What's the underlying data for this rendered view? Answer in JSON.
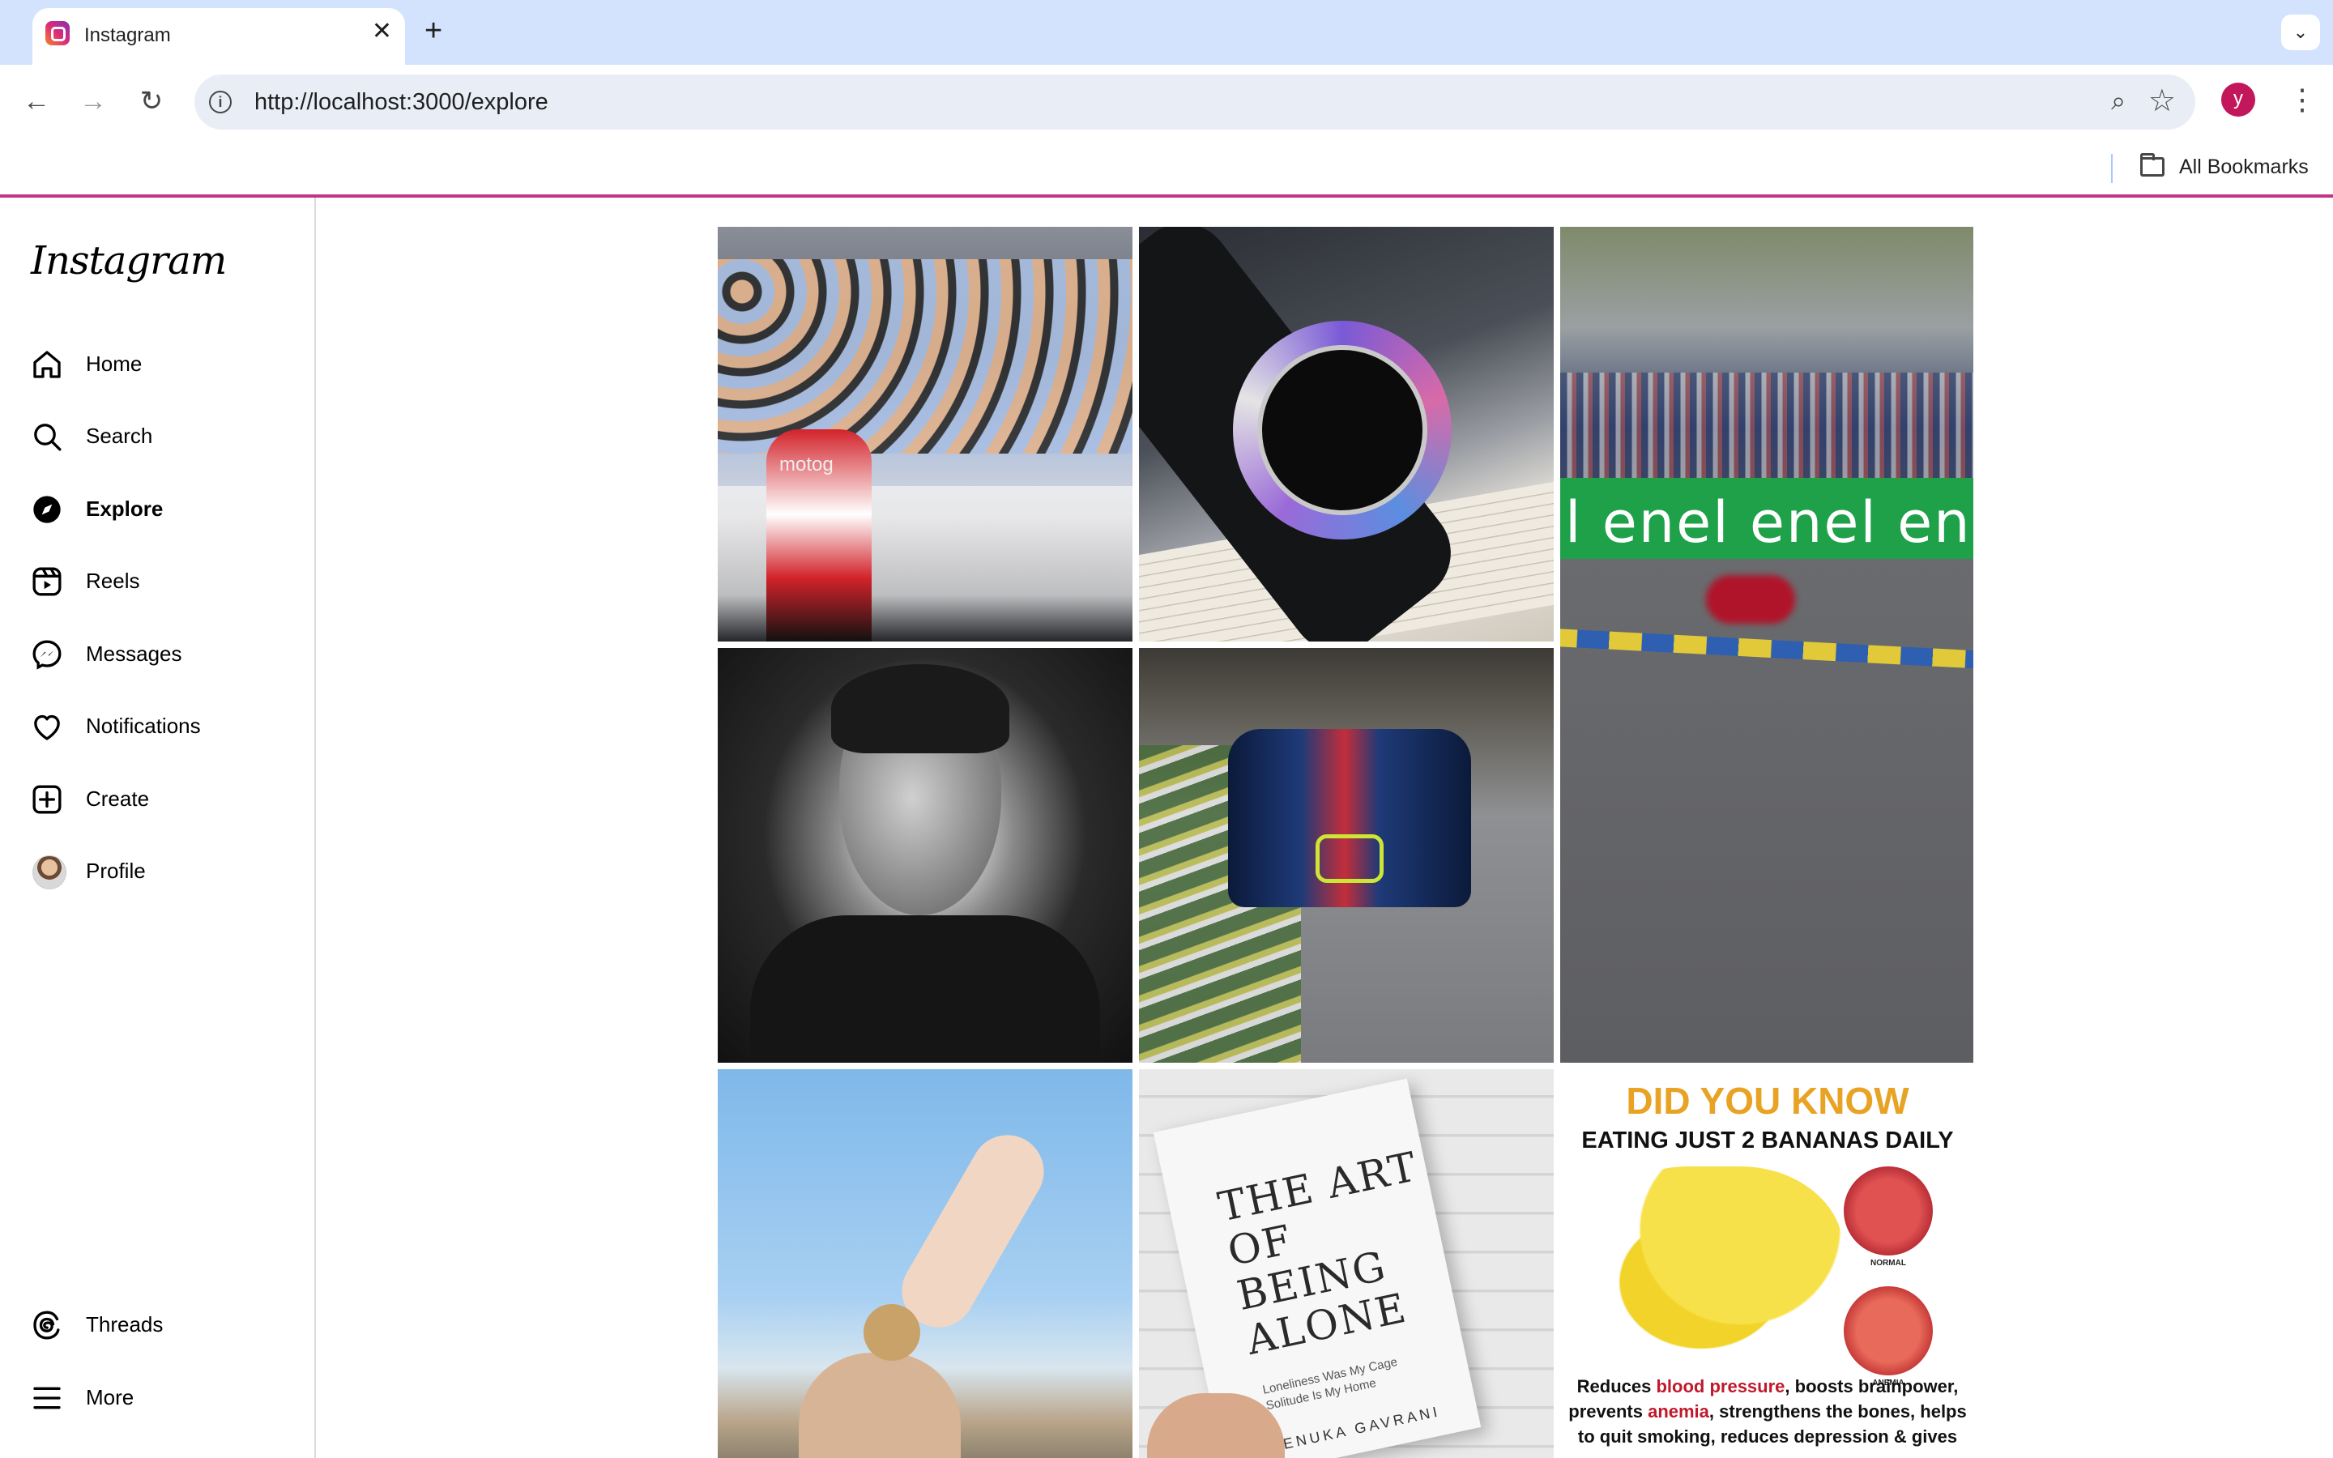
{
  "browser": {
    "tab_title": "Instagram",
    "url": "http://localhost:3000/explore",
    "bookmarks_folder": "All Bookmarks",
    "profile_initial": "y"
  },
  "sidebar": {
    "logo": "Instagram",
    "items": [
      {
        "label": "Home",
        "icon": "home-icon"
      },
      {
        "label": "Search",
        "icon": "search-icon"
      },
      {
        "label": "Explore",
        "icon": "compass-icon",
        "active": true
      },
      {
        "label": "Reels",
        "icon": "reels-icon"
      },
      {
        "label": "Messages",
        "icon": "messenger-icon"
      },
      {
        "label": "Notifications",
        "icon": "heart-icon"
      },
      {
        "label": "Create",
        "icon": "plus-square-icon"
      },
      {
        "label": "Profile",
        "icon": "avatar"
      }
    ],
    "bottom_items": [
      {
        "label": "Threads",
        "icon": "threads-icon"
      },
      {
        "label": "More",
        "icon": "hamburger-icon"
      }
    ]
  },
  "explore": {
    "posts": [
      {
        "subject": "motogp-team-celebration",
        "caption_text": "motog"
      },
      {
        "subject": "rolex-watch-on-book"
      },
      {
        "subject": "motogp-race-track-video",
        "banner_text": "l enel enel en"
      },
      {
        "subject": "black-white-portrait"
      },
      {
        "subject": "bmw-m-motorsport-race-car"
      },
      {
        "subject": "woman-waving-coastline"
      },
      {
        "subject": "book-the-art-of-being-alone",
        "book_title": "THE ART OF BEING ALONE",
        "book_subtitle": "Loneliness Was My Cage Solitude Is My Home",
        "book_author": "RENUKA GAVRANI"
      },
      {
        "subject": "banana-health-infographic",
        "headline": "DID YOU KNOW",
        "subheadline": "EATING JUST 2 BANANAS DAILY",
        "label_normal": "NORMAL",
        "label_anemia": "ANEMIA",
        "body_1": "Reduces ",
        "body_2": "blood pressure",
        "body_3": ", boosts brainpower, prevents ",
        "body_4": "anemia",
        "body_5": ", strengthens the bones, helps to quit smoking, reduces depression & gives"
      }
    ]
  },
  "colors": {
    "chrome_tabbar": "#d3e3fd",
    "omnibox": "#e9eef6",
    "accent_line": "#c13584",
    "headline_orange": "#e8a325"
  }
}
